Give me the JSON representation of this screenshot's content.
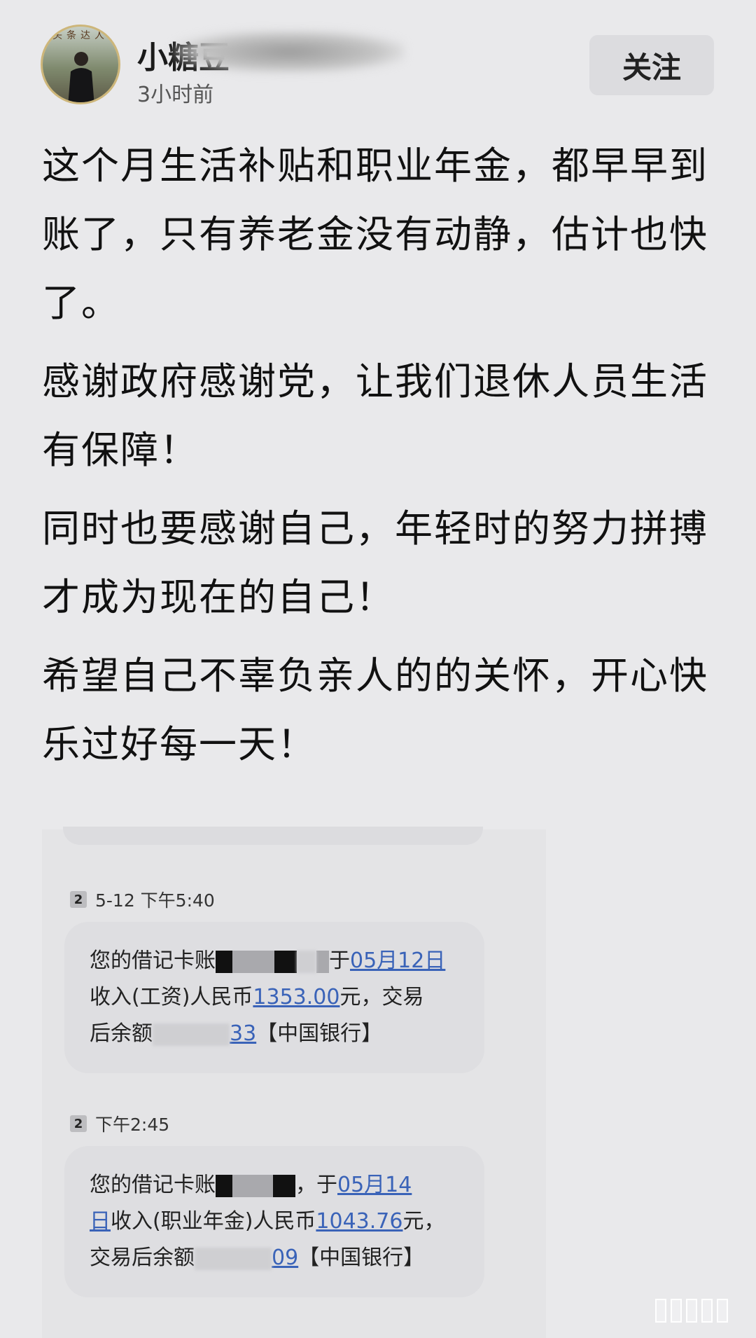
{
  "header": {
    "username": "小糖豆",
    "time": "3小时前",
    "follow_label": "关注",
    "avatar_banner": "头条达人"
  },
  "post": {
    "paragraphs": [
      "这个月生活补贴和职业年金，都早早到账了，只有养老金没有动静，估计也快了。",
      "感谢政府感谢党，让我们退休人员生活有保障！",
      "同时也要感谢自己，年轻时的努力拼搏才成为现在的自己！",
      "希望自己不辜负亲人的的关怀，开心快乐过好每一天！"
    ]
  },
  "messages": [
    {
      "sim": "2",
      "time": "5-12 下午5:40",
      "l1_a": "您的借记卡账",
      "l1_b": "于",
      "l1_date": "05月12日",
      "l2_a": "收入(工资)人民币",
      "l2_amount": "1353.00",
      "l2_b": "元，交易",
      "l3_a": "后余额",
      "l3_num": "33",
      "l3_b": "【中国银行】"
    },
    {
      "sim": "2",
      "time": "下午2:45",
      "l1_a": "您的借记卡账",
      "l1_b": "，于",
      "l1_date": "05月14",
      "l2_date_end": "日",
      "l2_a": "收入(职业年金)人民币",
      "l2_amount": "1043.76",
      "l2_b": "元，",
      "l3_a": "交易后余额",
      "l3_num": "09",
      "l3_b": "【中国银行】"
    }
  ]
}
